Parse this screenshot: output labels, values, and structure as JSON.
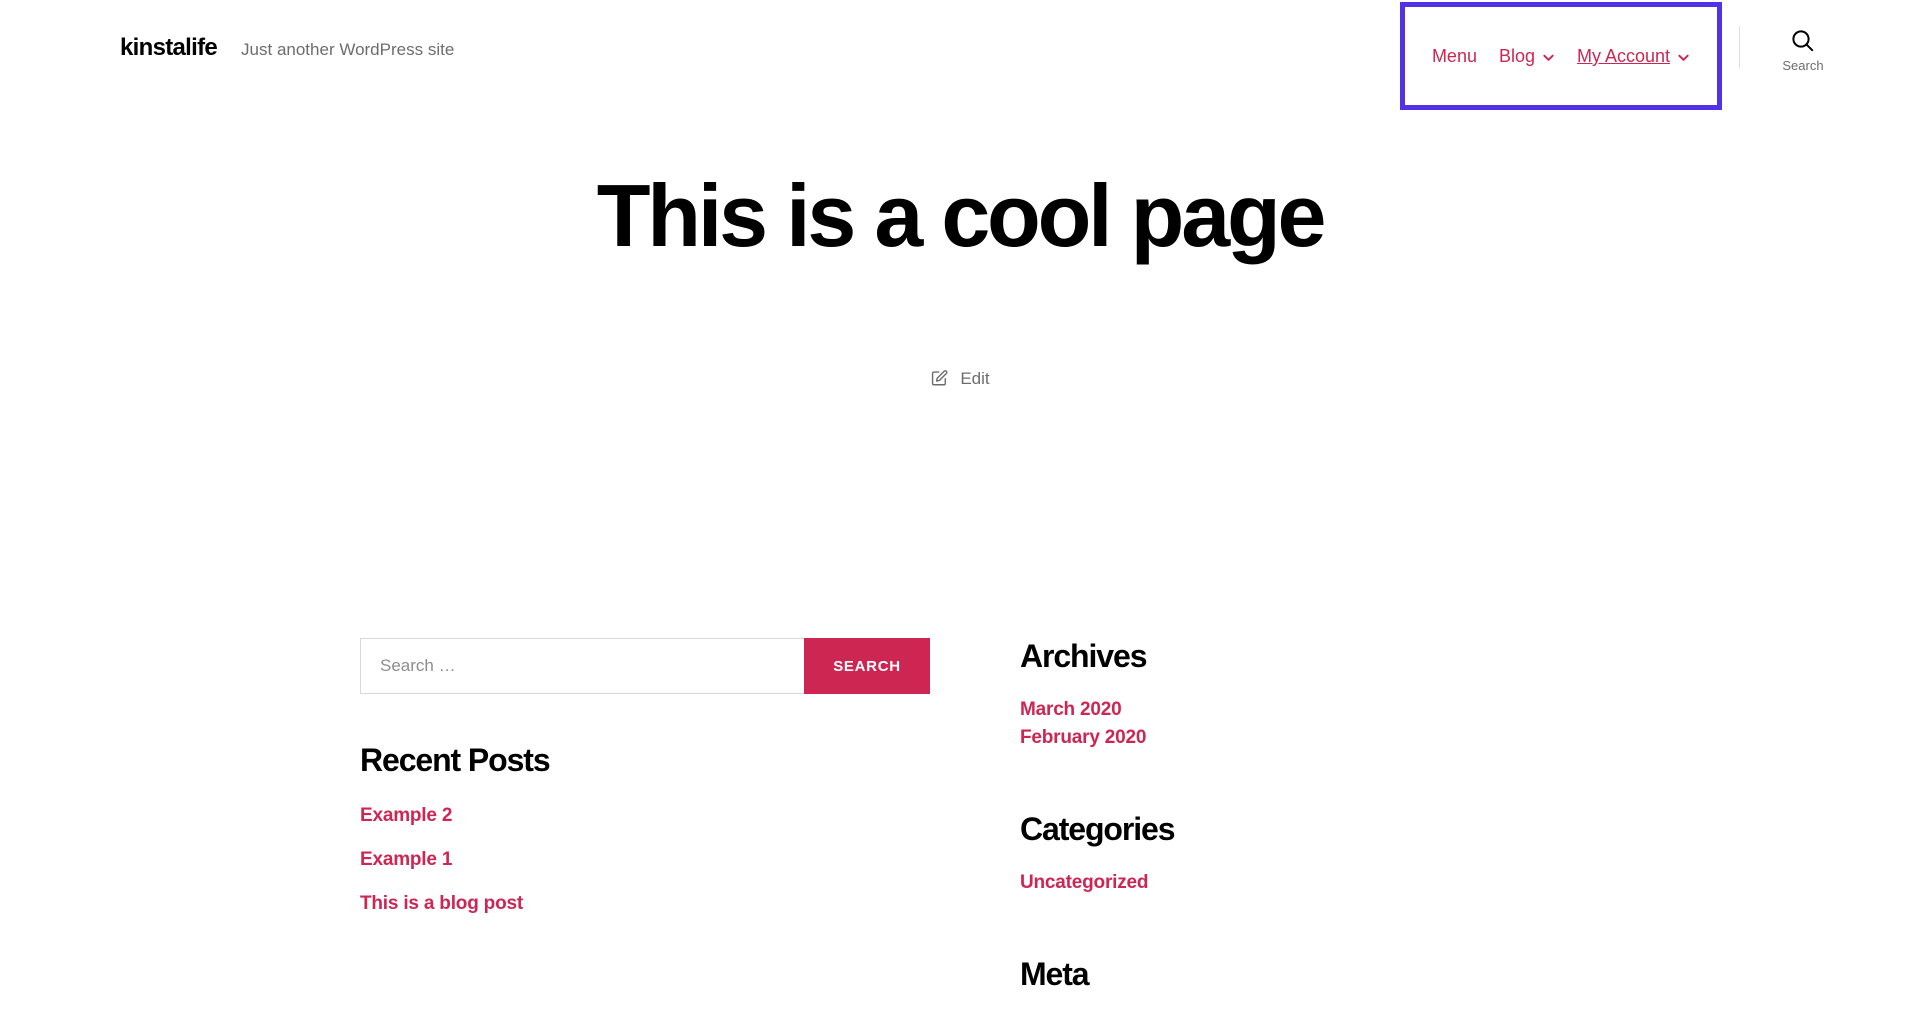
{
  "header": {
    "site_title": "kinstalife",
    "tagline": "Just another WordPress site",
    "nav": [
      {
        "label": "Menu",
        "has_dropdown": false,
        "current": false
      },
      {
        "label": "Blog",
        "has_dropdown": true,
        "current": false
      },
      {
        "label": "My Account",
        "has_dropdown": true,
        "current": true
      }
    ],
    "search_toggle_label": "Search",
    "search_icon": "magnifier-icon",
    "highlight_color": "#5232e8"
  },
  "page": {
    "title": "This is a cool page",
    "edit_label": "Edit",
    "edit_icon": "pencil-square-icon"
  },
  "sidebar": {
    "search": {
      "placeholder": "Search …",
      "value": "",
      "submit_label": "SEARCH"
    },
    "recent_posts": {
      "title": "Recent Posts",
      "items": [
        "Example 2",
        "Example 1",
        "This is a blog post"
      ]
    },
    "archives": {
      "title": "Archives",
      "items": [
        "March 2020",
        "February 2020"
      ]
    },
    "categories": {
      "title": "Categories",
      "items": [
        "Uncategorized"
      ]
    },
    "meta": {
      "title": "Meta"
    }
  },
  "colors": {
    "accent": "#cd2653",
    "text": "#000000",
    "muted": "#6d6d6d",
    "highlight": "#5232e8"
  }
}
